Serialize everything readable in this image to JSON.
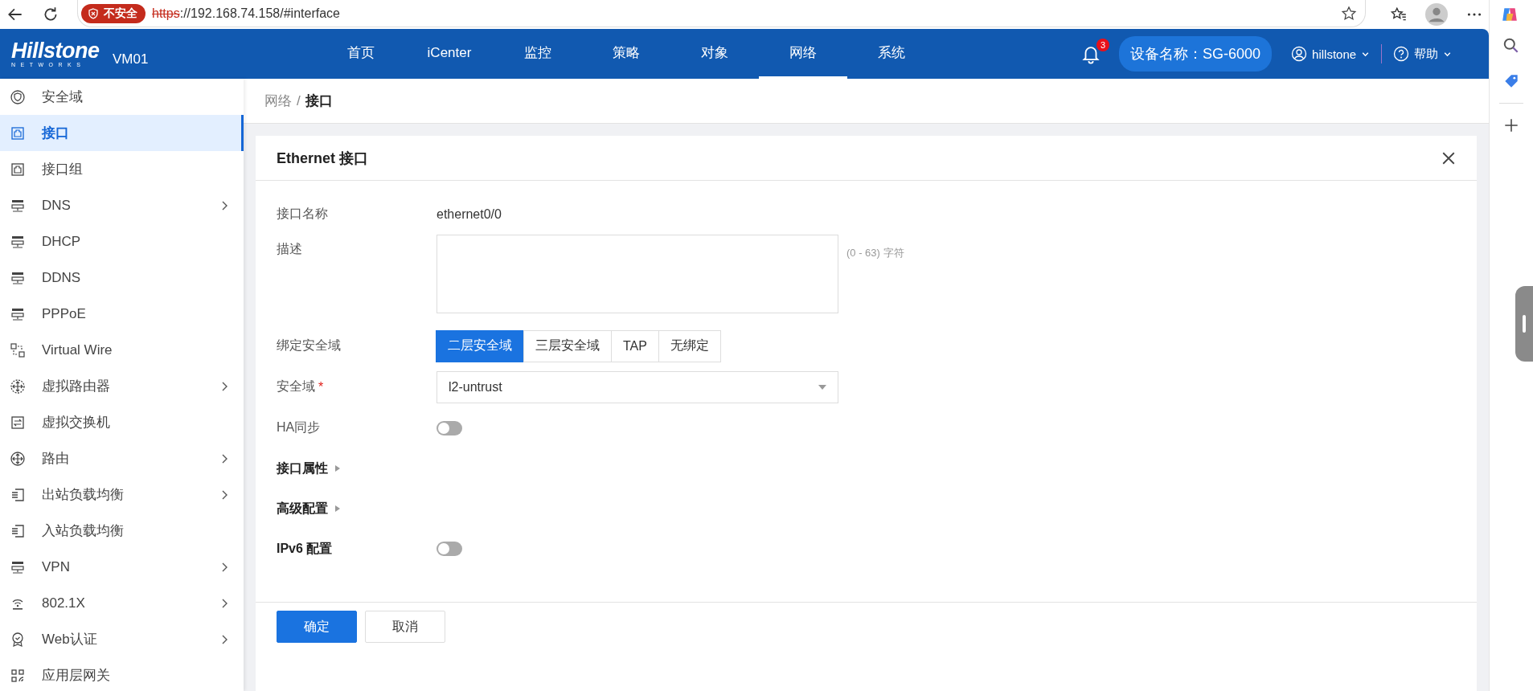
{
  "browser": {
    "security_badge": "不安全",
    "url_scheme": "https",
    "url_rest": "://192.168.74.158/#interface"
  },
  "header": {
    "logo": "Hillstone",
    "logo_sub": "NETWORKS",
    "device": "VM01",
    "nav": [
      {
        "label": "首页",
        "selected": false
      },
      {
        "label": "iCenter",
        "selected": false
      },
      {
        "label": "监控",
        "selected": false
      },
      {
        "label": "策略",
        "selected": false
      },
      {
        "label": "对象",
        "selected": false
      },
      {
        "label": "网络",
        "selected": true
      },
      {
        "label": "系统",
        "selected": false
      }
    ],
    "notifications": "3",
    "device_name": "设备名称：SG-6000",
    "user": "hillstone",
    "help": "帮助"
  },
  "sidebar": {
    "items": [
      {
        "label": "安全域",
        "selected": false,
        "has_children": false
      },
      {
        "label": "接口",
        "selected": true,
        "has_children": false
      },
      {
        "label": "接口组",
        "selected": false,
        "has_children": false
      },
      {
        "label": "DNS",
        "selected": false,
        "has_children": true
      },
      {
        "label": "DHCP",
        "selected": false,
        "has_children": false
      },
      {
        "label": "DDNS",
        "selected": false,
        "has_children": false
      },
      {
        "label": "PPPoE",
        "selected": false,
        "has_children": false
      },
      {
        "label": "Virtual Wire",
        "selected": false,
        "has_children": false
      },
      {
        "label": "虚拟路由器",
        "selected": false,
        "has_children": true
      },
      {
        "label": "虚拟交换机",
        "selected": false,
        "has_children": false
      },
      {
        "label": "路由",
        "selected": false,
        "has_children": true
      },
      {
        "label": "出站负载均衡",
        "selected": false,
        "has_children": true
      },
      {
        "label": "入站负载均衡",
        "selected": false,
        "has_children": false
      },
      {
        "label": "VPN",
        "selected": false,
        "has_children": true
      },
      {
        "label": "802.1X",
        "selected": false,
        "has_children": true
      },
      {
        "label": "Web认证",
        "selected": false,
        "has_children": true
      },
      {
        "label": "应用层网关",
        "selected": false,
        "has_children": false
      }
    ]
  },
  "breadcrumb": {
    "parent": "网络",
    "separator": "/",
    "current": "接口"
  },
  "dialog": {
    "title": "Ethernet 接口",
    "fields": [
      {
        "kind": "text",
        "label": "接口名称",
        "value": "ethernet0/0"
      },
      {
        "kind": "textarea",
        "label": "描述",
        "hint": "(0 - 63) 字符"
      },
      {
        "kind": "segmented",
        "label": "绑定安全域",
        "options": [
          {
            "label": "二层安全域",
            "selected": true
          },
          {
            "label": "三层安全域",
            "selected": false
          },
          {
            "label": "TAP",
            "selected": false
          },
          {
            "label": "无绑定",
            "selected": false
          }
        ]
      },
      {
        "kind": "select",
        "label": "安全域",
        "required_mark": "*",
        "value": "l2-untrust"
      },
      {
        "kind": "toggle",
        "label": "HA同步",
        "on": false
      },
      {
        "kind": "section",
        "label": "接口属性",
        "expanded": false
      },
      {
        "kind": "section",
        "label": "高级配置",
        "expanded": false
      },
      {
        "kind": "section_toggle",
        "label": "IPv6 配置",
        "on": false
      }
    ],
    "buttons": [
      {
        "label": "确定",
        "kind": "primary"
      },
      {
        "label": "取消",
        "kind": "default"
      }
    ]
  }
}
